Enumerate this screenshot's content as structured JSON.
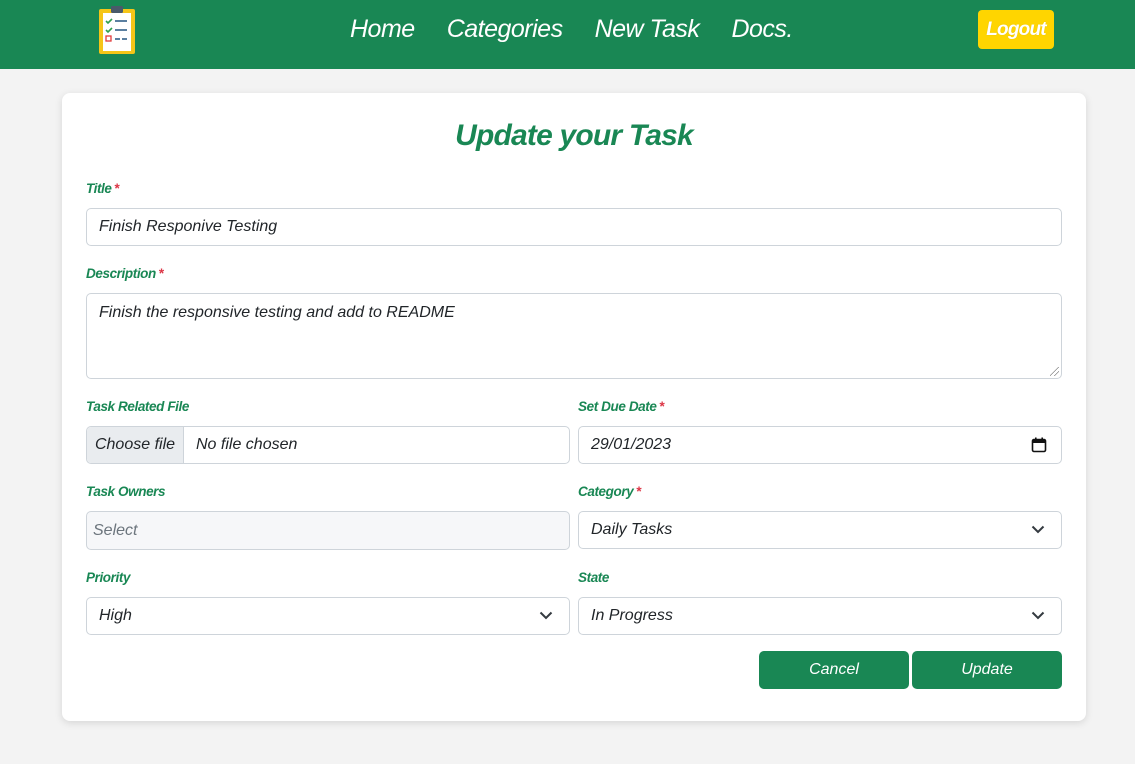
{
  "colors": {
    "brand": "#198754",
    "logout": "#ffd500",
    "required": "#dc3545"
  },
  "nav": {
    "logo_icon": "clipboard-checklist-icon",
    "links": [
      "Home",
      "Categories",
      "New Task",
      "Docs."
    ],
    "logout_label": "Logout"
  },
  "form": {
    "heading": "Update your Task",
    "required_mark": "*",
    "title": {
      "label": "Title",
      "value": "Finish Responive Testing"
    },
    "description": {
      "label": "Description",
      "value": "Finish the responsive testing and add to README"
    },
    "file": {
      "label": "Task Related File",
      "button": "Choose file",
      "status": "No file chosen"
    },
    "due_date": {
      "label": "Set Due Date",
      "value": "29/01/2023",
      "icon": "calendar-icon"
    },
    "owners": {
      "label": "Task Owners",
      "placeholder": "Select"
    },
    "category": {
      "label": "Category",
      "value": "Daily Tasks"
    },
    "priority": {
      "label": "Priority",
      "value": "High"
    },
    "state": {
      "label": "State",
      "value": "In Progress"
    },
    "cancel_label": "Cancel",
    "update_label": "Update"
  }
}
